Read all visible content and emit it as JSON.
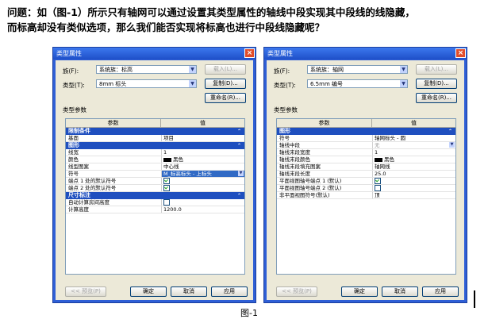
{
  "question": {
    "line1": "问题：如（图-1）所示只有轴网可以通过设置其类型属性的轴线中段实现其中段线的线隐藏，",
    "line2": "而标高却没有类似选项，那么我们能否实现将标高也进行中段线隐藏呢？"
  },
  "caption": "图-1",
  "left": {
    "title": "类型属性",
    "family_label": "族(F):",
    "family_value": "系统族：标高",
    "load_button": "载入(L)...",
    "type_label": "类型(T):",
    "type_value": "8mm 标头",
    "duplicate_button": "复制(D)...",
    "rename_button": "重命名(R)...",
    "type_params_label": "类型参数",
    "col_param": "参数",
    "col_value": "值",
    "sections": [
      {
        "title": "限制条件",
        "rows": [
          {
            "k": "基面",
            "v": "项目"
          }
        ]
      },
      {
        "title": "图形",
        "rows": [
          {
            "k": "线宽",
            "v": "1"
          },
          {
            "k": "颜色",
            "v": "黑色"
          },
          {
            "k": "线型图案",
            "v": "中心线"
          },
          {
            "k": "符号",
            "v": "M_标高标头 - 上标头"
          },
          {
            "k": "端点 1 处的默认符号",
            "v": ""
          },
          {
            "k": "端点 2 处的默认符号",
            "v": ""
          }
        ]
      },
      {
        "title": "尺寸标注",
        "rows": [
          {
            "k": "自动计算房间高度",
            "v": ""
          },
          {
            "k": "计算高度",
            "v": "1200.0"
          }
        ]
      }
    ],
    "preview_button": "<< 预览(P)",
    "ok_button": "确定",
    "cancel_button": "取消",
    "apply_button": "应用"
  },
  "right": {
    "title": "类型属性",
    "family_label": "族(F):",
    "family_value": "系统族：轴网",
    "load_button": "载入(L)...",
    "type_label": "类型(T):",
    "type_value": "6.5mm 编号",
    "duplicate_button": "复制(D)...",
    "rename_button": "重命名(R)...",
    "type_params_label": "类型参数",
    "col_param": "参数",
    "col_value": "值",
    "sections": [
      {
        "title": "图形",
        "rows": [
          {
            "k": "符号",
            "v": "轴网标头 - 圆"
          },
          {
            "k": "轴线中段",
            "v": "无"
          },
          {
            "k": "轴线末段宽度",
            "v": "1"
          },
          {
            "k": "轴线末段颜色",
            "v": "黑色"
          },
          {
            "k": "轴线末段填充图案",
            "v": "轴网线"
          },
          {
            "k": "轴线末段长度",
            "v": "25.0"
          },
          {
            "k": "平面视图轴号端点 1 (默认)",
            "v": ""
          },
          {
            "k": "平面视图轴号端点 2 (默认)",
            "v": ""
          },
          {
            "k": "非平面视图符号(默认)",
            "v": "顶"
          }
        ]
      }
    ],
    "preview_button": "<< 预览(P)",
    "ok_button": "确定",
    "cancel_button": "取消",
    "apply_button": "应用"
  }
}
